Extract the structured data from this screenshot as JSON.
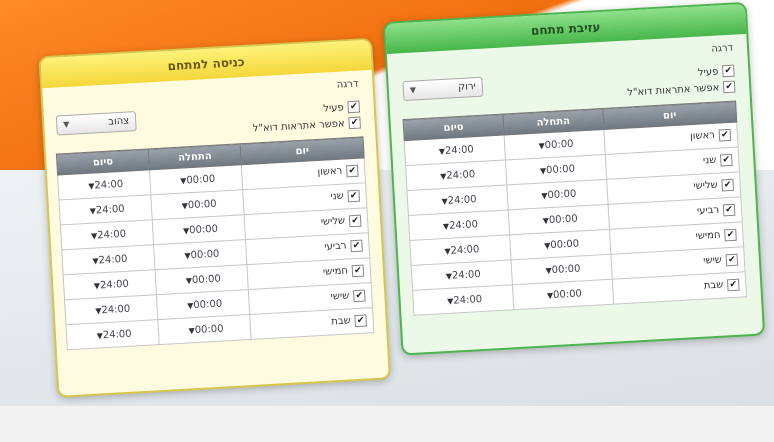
{
  "panels": {
    "enter": {
      "title": "כניסה למתחם",
      "level_label": "דרגה",
      "level_value": "צהוב",
      "active_label": "פעיל",
      "email_label": "אפשר אתראות דוא\"ל",
      "col_day": "יום",
      "col_start": "התחלה",
      "col_end": "סיום",
      "days": [
        "ראשון",
        "שני",
        "שלישי",
        "רביעי",
        "חמישי",
        "שישי",
        "שבת"
      ],
      "start_time": "00:00",
      "end_time": "24:00"
    },
    "leave": {
      "title": "עזיבת מתחם",
      "level_label": "דרגה",
      "level_value": "ירוק",
      "active_label": "פעיל",
      "email_label": "אפשר אתראות דוא\"ל",
      "col_day": "יום",
      "col_start": "התחלה",
      "col_end": "סיום",
      "days": [
        "ראשון",
        "שני",
        "שלישי",
        "רביעי",
        "חמישי",
        "שישי",
        "שבת"
      ],
      "start_time": "00:00",
      "end_time": "24:00"
    }
  },
  "colors": {
    "yellow": "#fff27a",
    "green": "#47b64a",
    "orange": "#f07010"
  }
}
